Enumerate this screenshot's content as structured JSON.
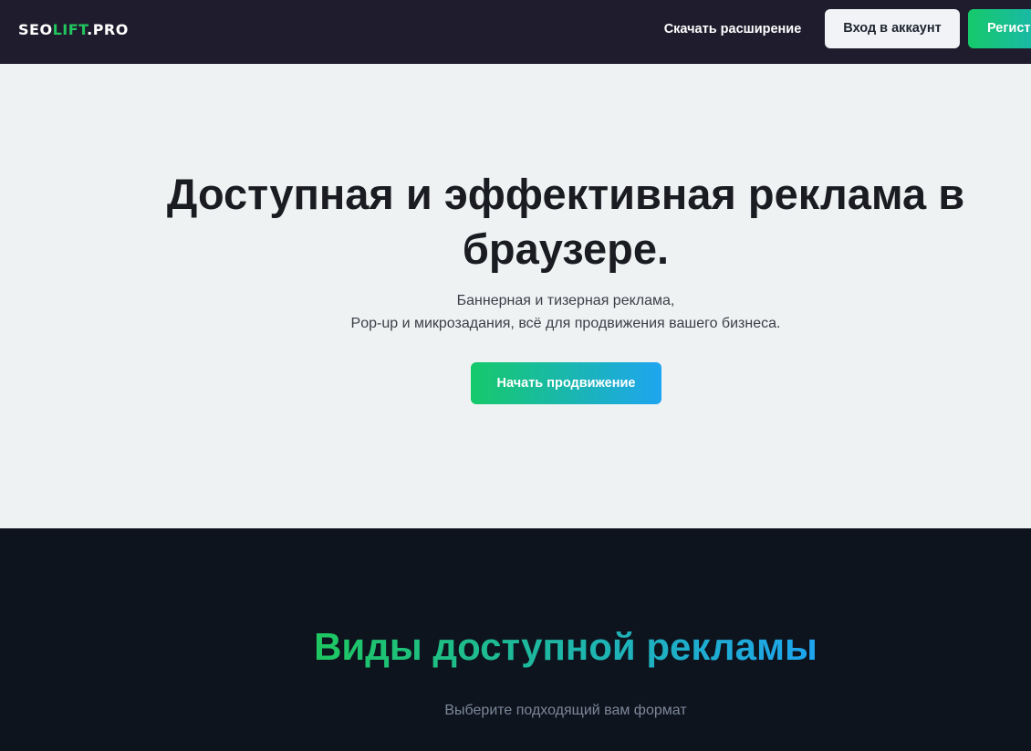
{
  "header": {
    "logo": {
      "part1": "SEO",
      "part2": "LIFT",
      "part3": ".PRO"
    },
    "download_label": "Скачать расширение",
    "login_label": "Вход в аккаунт",
    "register_label": "Регист"
  },
  "hero": {
    "title": "Доступная и эффективная реклама в браузере.",
    "subtitle_line1": "Баннерная и тизерная реклама,",
    "subtitle_line2": "Pop-up и микрозадания, всё для продвижения вашего бизнеса.",
    "cta_label": "Начать продвижение"
  },
  "ad_types": {
    "title": "Виды доступной рекламы",
    "subtitle": "Выберите подходящий вам формат"
  },
  "colors": {
    "header_bg": "#1f1d2d",
    "hero_bg": "#eff2f3",
    "section_bg": "#0e141e",
    "accent_green": "#16c96a",
    "accent_blue": "#1ea5f0"
  }
}
